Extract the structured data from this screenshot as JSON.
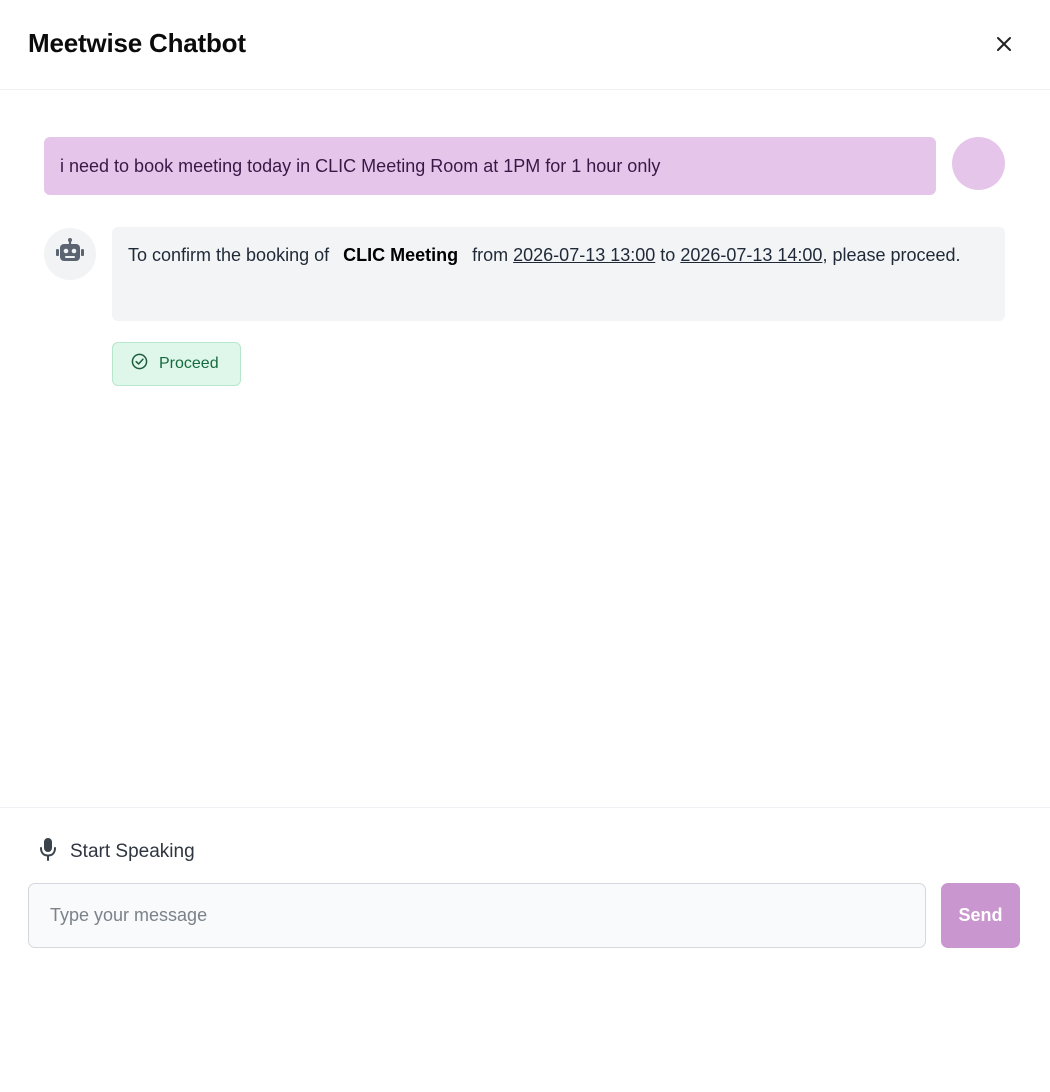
{
  "header": {
    "title": "Meetwise Chatbot",
    "close_icon": "close-icon"
  },
  "messages": [
    {
      "role": "user",
      "text": "i need to book meeting today in CLIC Meeting Room at 1PM for 1 hour only"
    },
    {
      "role": "bot",
      "avatar_icon": "robot-icon",
      "prefix": "To confirm the booking of",
      "room": "CLIC Meeting",
      "from_label": "from",
      "start": "2026-07-13 13:00",
      "to_label": "to",
      "end": "2026-07-13 14:00",
      "suffix": ", please proceed."
    }
  ],
  "actions": {
    "proceed_label": "Proceed",
    "proceed_icon": "check-circle-icon"
  },
  "footer": {
    "speak_label": "Start Speaking",
    "speak_icon": "microphone-icon",
    "input_placeholder": "Type your message",
    "input_value": "",
    "send_label": "Send"
  },
  "colors": {
    "user_bubble": "#e5c6ea",
    "bot_bubble": "#f2f4f6",
    "proceed_bg": "#dff7ea",
    "proceed_text": "#166a3f",
    "send_bg": "#c996cf"
  }
}
